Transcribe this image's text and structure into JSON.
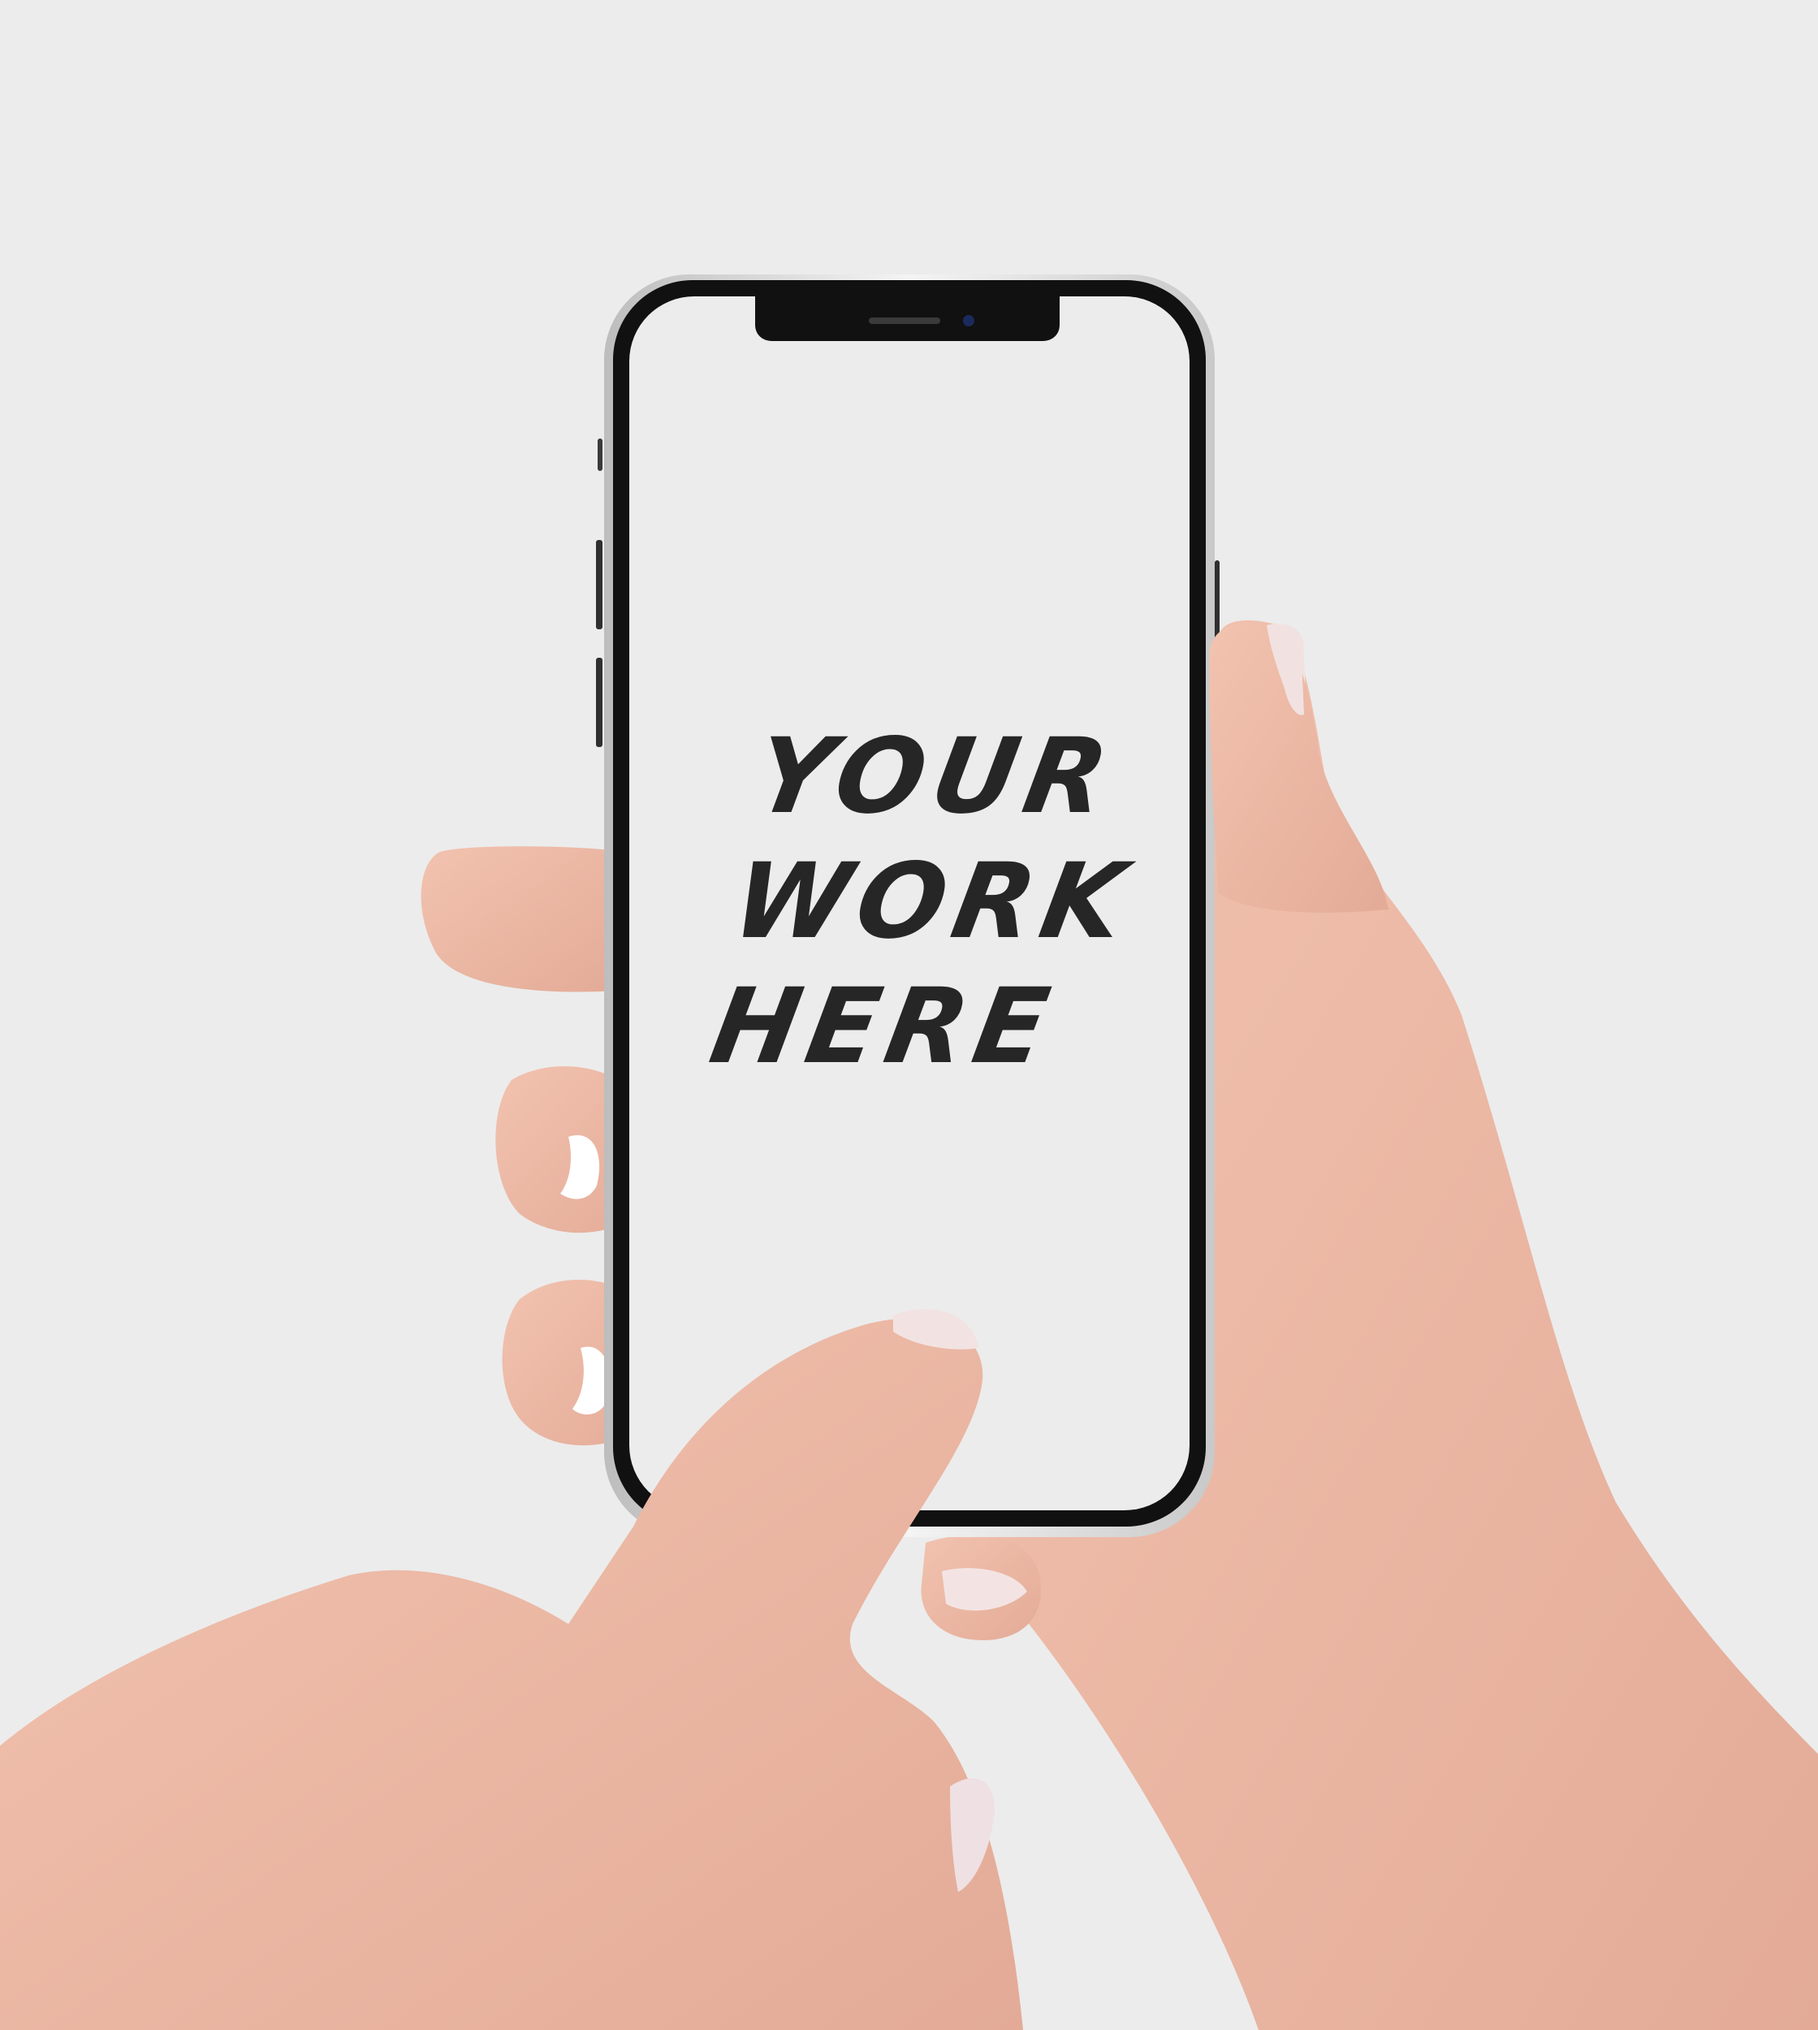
{
  "mockup": {
    "placeholder_lines": [
      "YOUR",
      "WORK",
      "HERE"
    ],
    "background_color": "#ececec",
    "screen_color": "#ececec",
    "bezel_color": "#111111",
    "frame_color": "#d8d8d8",
    "skin_color": "#e9b7a4",
    "nail_color": "#f0e1e0"
  }
}
